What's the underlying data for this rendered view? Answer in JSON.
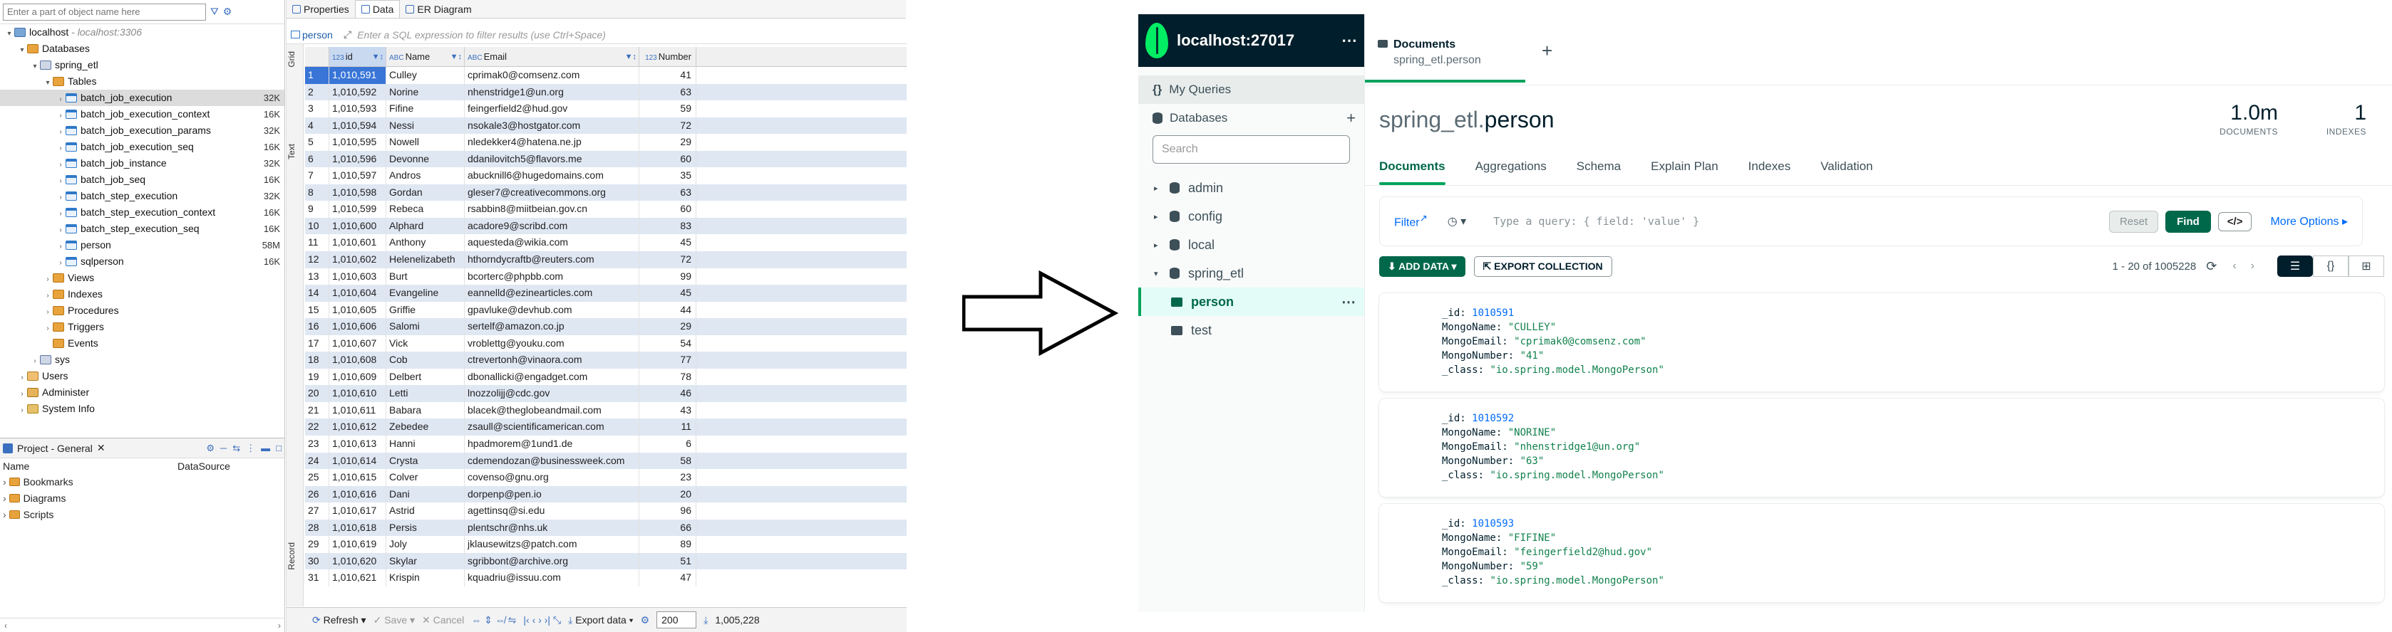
{
  "dbeaver": {
    "filter_placeholder": "Enter a part of object name here",
    "tree": [
      {
        "label": "localhost",
        "sub": " - localhost:3306",
        "icon": "server",
        "depth": 0,
        "arrow": "▾"
      },
      {
        "label": "Databases",
        "icon": "folder",
        "depth": 1,
        "arrow": "▾"
      },
      {
        "label": "spring_etl",
        "icon": "db",
        "depth": 2,
        "arrow": "▾"
      },
      {
        "label": "Tables",
        "icon": "folder",
        "depth": 3,
        "arrow": "▾"
      },
      {
        "label": "batch_job_execution",
        "icon": "table",
        "depth": 4,
        "arrow": "›",
        "size": "32K",
        "selected": true
      },
      {
        "label": "batch_job_execution_context",
        "icon": "table",
        "depth": 4,
        "arrow": "›",
        "size": "16K"
      },
      {
        "label": "batch_job_execution_params",
        "icon": "table",
        "depth": 4,
        "arrow": "›",
        "size": "32K"
      },
      {
        "label": "batch_job_execution_seq",
        "icon": "table",
        "depth": 4,
        "arrow": "›",
        "size": "16K"
      },
      {
        "label": "batch_job_instance",
        "icon": "table",
        "depth": 4,
        "arrow": "›",
        "size": "32K"
      },
      {
        "label": "batch_job_seq",
        "icon": "table",
        "depth": 4,
        "arrow": "›",
        "size": "16K"
      },
      {
        "label": "batch_step_execution",
        "icon": "table",
        "depth": 4,
        "arrow": "›",
        "size": "32K"
      },
      {
        "label": "batch_step_execution_context",
        "icon": "table",
        "depth": 4,
        "arrow": "›",
        "size": "16K"
      },
      {
        "label": "batch_step_execution_seq",
        "icon": "table",
        "depth": 4,
        "arrow": "›",
        "size": "16K"
      },
      {
        "label": "person",
        "icon": "table",
        "depth": 4,
        "arrow": "›",
        "size": "58M"
      },
      {
        "label": "sqlperson",
        "icon": "table",
        "depth": 4,
        "arrow": "›",
        "size": "16K"
      },
      {
        "label": "Views",
        "icon": "folder",
        "depth": 3,
        "arrow": "›"
      },
      {
        "label": "Indexes",
        "icon": "folder",
        "depth": 3,
        "arrow": "›"
      },
      {
        "label": "Procedures",
        "icon": "folder",
        "depth": 3,
        "arrow": "›"
      },
      {
        "label": "Triggers",
        "icon": "folder",
        "depth": 3,
        "arrow": "›"
      },
      {
        "label": "Events",
        "icon": "folder",
        "depth": 3,
        "arrow": ""
      },
      {
        "label": "sys",
        "icon": "db",
        "depth": 2,
        "arrow": "›"
      },
      {
        "label": "Users",
        "icon": "user",
        "depth": 1,
        "arrow": "›"
      },
      {
        "label": "Administer",
        "icon": "admin",
        "depth": 1,
        "arrow": "›"
      },
      {
        "label": "System Info",
        "icon": "info",
        "depth": 1,
        "arrow": "›"
      }
    ],
    "project": {
      "title": "Project - General",
      "col_name": "Name",
      "col_source": "DataSource",
      "items": [
        "Bookmarks",
        "Diagrams",
        "Scripts"
      ]
    },
    "tabs": [
      "Properties",
      "Data",
      "ER Diagram"
    ],
    "active_tab": "Data",
    "table_name": "person",
    "sql_placeholder": "Enter a SQL expression to filter results (use Ctrl+Space)",
    "side_labels": [
      "Grid",
      "Text",
      "Record"
    ],
    "columns": [
      "id",
      "Name",
      "Email",
      "Number"
    ],
    "rows": [
      [
        "1",
        "1,010,591",
        "Culley",
        "cprimak0@comsenz.com",
        "41"
      ],
      [
        "2",
        "1,010,592",
        "Norine",
        "nhenstridge1@un.org",
        "63"
      ],
      [
        "3",
        "1,010,593",
        "Fifine",
        "feingerfield2@hud.gov",
        "59"
      ],
      [
        "4",
        "1,010,594",
        "Nessi",
        "nsokale3@hostgator.com",
        "72"
      ],
      [
        "5",
        "1,010,595",
        "Nowell",
        "nledekker4@hatena.ne.jp",
        "29"
      ],
      [
        "6",
        "1,010,596",
        "Devonne",
        "ddanilovitch5@flavors.me",
        "60"
      ],
      [
        "7",
        "1,010,597",
        "Andros",
        "abucknill6@hugedomains.com",
        "35"
      ],
      [
        "8",
        "1,010,598",
        "Gordan",
        "gleser7@creativecommons.org",
        "63"
      ],
      [
        "9",
        "1,010,599",
        "Rebeca",
        "rsabbin8@miitbeian.gov.cn",
        "60"
      ],
      [
        "10",
        "1,010,600",
        "Alphard",
        "acadore9@scribd.com",
        "83"
      ],
      [
        "11",
        "1,010,601",
        "Anthony",
        "aquesteda@wikia.com",
        "45"
      ],
      [
        "12",
        "1,010,602",
        "Helenelizabeth",
        "hthorndycraftb@reuters.com",
        "72"
      ],
      [
        "13",
        "1,010,603",
        "Burt",
        "bcorterc@phpbb.com",
        "99"
      ],
      [
        "14",
        "1,010,604",
        "Evangeline",
        "eannelld@ezinearticles.com",
        "45"
      ],
      [
        "15",
        "1,010,605",
        "Griffie",
        "gpavluke@devhub.com",
        "44"
      ],
      [
        "16",
        "1,010,606",
        "Salomi",
        "sertelf@amazon.co.jp",
        "29"
      ],
      [
        "17",
        "1,010,607",
        "Vick",
        "vroblettg@youku.com",
        "54"
      ],
      [
        "18",
        "1,010,608",
        "Cob",
        "ctrevertonh@vinaora.com",
        "77"
      ],
      [
        "19",
        "1,010,609",
        "Delbert",
        "dbonallicki@engadget.com",
        "78"
      ],
      [
        "20",
        "1,010,610",
        "Letti",
        "lnozzolijj@cdc.gov",
        "46"
      ],
      [
        "21",
        "1,010,611",
        "Babara",
        "blacek@theglobeandmail.com",
        "43"
      ],
      [
        "22",
        "1,010,612",
        "Zebedee",
        "zsaull@scientificamerican.com",
        "11"
      ],
      [
        "23",
        "1,010,613",
        "Hanni",
        "hpadmorem@1und1.de",
        "6"
      ],
      [
        "24",
        "1,010,614",
        "Crysta",
        "cdemendozan@businessweek.com",
        "58"
      ],
      [
        "25",
        "1,010,615",
        "Colver",
        "covenso@gnu.org",
        "23"
      ],
      [
        "26",
        "1,010,616",
        "Dani",
        "dorpenp@pen.io",
        "20"
      ],
      [
        "27",
        "1,010,617",
        "Astrid",
        "agettinsq@si.edu",
        "96"
      ],
      [
        "28",
        "1,010,618",
        "Persis",
        "plentschr@nhs.uk",
        "66"
      ],
      [
        "29",
        "1,010,619",
        "Joly",
        "jklausewitzs@patch.com",
        "89"
      ],
      [
        "30",
        "1,010,620",
        "Skylar",
        "sgribbont@archive.org",
        "51"
      ],
      [
        "31",
        "1,010,621",
        "Krispin",
        "kquadriu@issuu.com",
        "47"
      ]
    ],
    "bottom": {
      "refresh": "Refresh",
      "save": "Save",
      "cancel": "Cancel",
      "export": "Export data",
      "fetch_size": "200",
      "total": "1,005,228"
    }
  },
  "compass": {
    "host": "localhost:27017",
    "my_queries": "My Queries",
    "databases": "Databases",
    "search_placeholder": "Search",
    "dbs": [
      "admin",
      "config",
      "local",
      "spring_etl"
    ],
    "collections": [
      "person",
      "test"
    ],
    "active_collection": "person",
    "tab_title": "Documents",
    "tab_sub": "spring_etl.person",
    "title_db": "spring_etl",
    "title_coll": "person",
    "documents_count": "1.0m",
    "documents_label": "DOCUMENTS",
    "indexes_count": "1",
    "indexes_label": "INDEXES",
    "subtabs": [
      "Documents",
      "Aggregations",
      "Schema",
      "Explain Plan",
      "Indexes",
      "Validation"
    ],
    "filter_label": "Filter",
    "query_placeholder": "Type a query: { field: 'value' }",
    "reset": "Reset",
    "find": "Find",
    "more_options": "More Options",
    "add_data": "ADD DATA",
    "export_collection": "EXPORT COLLECTION",
    "pagination": "1 - 20 of 1005228",
    "docs": [
      {
        "id": "1010591",
        "name": "\"CULLEY\"",
        "email": "\"cprimak0@comsenz.com\"",
        "number": "\"41\"",
        "cls": "\"io.spring.model.MongoPerson\""
      },
      {
        "id": "1010592",
        "name": "\"NORINE\"",
        "email": "\"nhenstridge1@un.org\"",
        "number": "\"63\"",
        "cls": "\"io.spring.model.MongoPerson\""
      },
      {
        "id": "1010593",
        "name": "\"FIFINE\"",
        "email": "\"feingerfield2@hud.gov\"",
        "number": "\"59\"",
        "cls": "\"io.spring.model.MongoPerson\""
      }
    ],
    "doc_keys": {
      "id": "_id",
      "name": "MongoName",
      "email": "MongoEmail",
      "number": "MongoNumber",
      "cls": "_class"
    }
  }
}
